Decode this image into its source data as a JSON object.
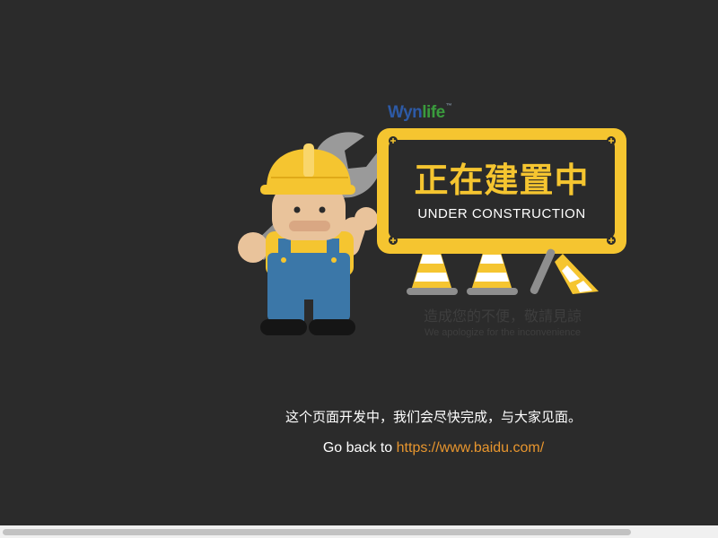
{
  "brand": {
    "logo_main": "Wyn",
    "logo_accent": "life",
    "logo_mark": "™",
    "colors": {
      "main": "#2d5aa6",
      "accent": "#3a9b3d"
    }
  },
  "sign": {
    "title": "正在建置中",
    "subtitle": "UNDER CONSTRUCTION",
    "colors": {
      "frame": "#f5c530",
      "board": "#2b2b2b",
      "title": "#f5c530"
    }
  },
  "apology": {
    "chinese": "造成您的不便，敬請見諒",
    "english": "We apologize for the inconvenience"
  },
  "message": {
    "text": "这个页面开发中，我们会尽快完成，与大家见面。"
  },
  "goback": {
    "prefix": "Go back to",
    "link_text": "https://www.baidu.com/",
    "link_color": "#e8962e"
  },
  "icons": {
    "worker": "construction-worker-icon",
    "wrench": "wrench-icon",
    "cone": "traffic-cone-icon",
    "screw": "screw-icon"
  },
  "theme": {
    "background": "#2b2b2b"
  }
}
